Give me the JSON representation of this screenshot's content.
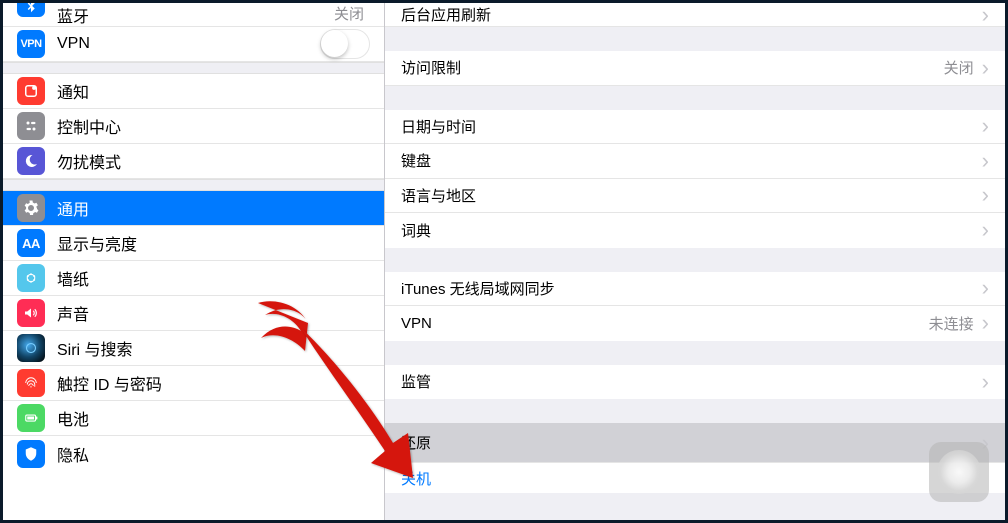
{
  "sidebar": {
    "bluetooth": {
      "label": "蓝牙",
      "value": "关闭"
    },
    "vpn": {
      "label": "VPN",
      "badge": "VPN"
    },
    "notifications": {
      "label": "通知"
    },
    "control_center": {
      "label": "控制中心"
    },
    "dnd": {
      "label": "勿扰模式"
    },
    "general": {
      "label": "通用"
    },
    "display": {
      "label": "显示与亮度",
      "badge": "AA"
    },
    "wallpaper": {
      "label": "墙纸"
    },
    "sound": {
      "label": "声音"
    },
    "siri": {
      "label": "Siri 与搜索"
    },
    "touchid": {
      "label": "触控 ID 与密码"
    },
    "battery": {
      "label": "电池"
    },
    "privacy": {
      "label": "隐私"
    }
  },
  "detail": {
    "background_refresh": "后台应用刷新",
    "restrictions": {
      "label": "访问限制",
      "value": "关闭"
    },
    "date_time": "日期与时间",
    "keyboard": "键盘",
    "language_region": "语言与地区",
    "dictionary": "词典",
    "itunes_wifi_sync": "iTunes 无线局域网同步",
    "vpn": {
      "label": "VPN",
      "value": "未连接"
    },
    "profiles": "监管",
    "reset": "还原",
    "shutdown": "关机"
  }
}
